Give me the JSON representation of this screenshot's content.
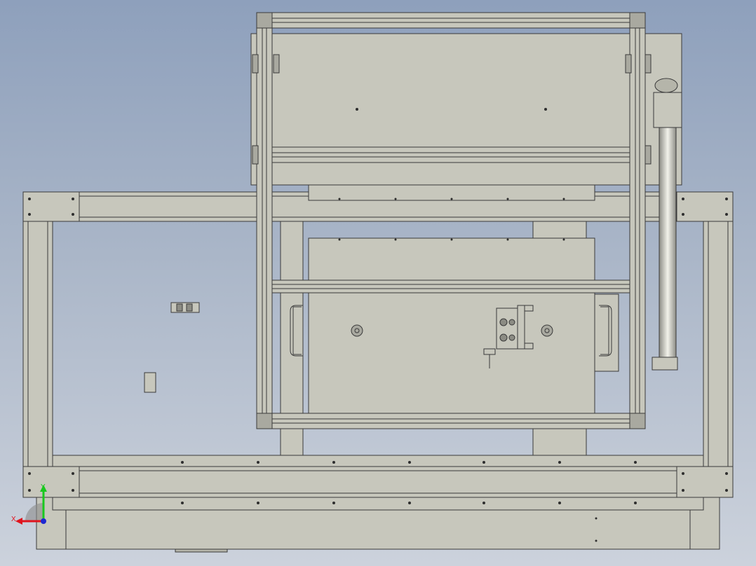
{
  "viewport": {
    "background_top": "#8ea0bc",
    "background_bottom": "#ccd2dc",
    "part_fill": "#c7c7bc",
    "part_fill_light": "#d4d4ca",
    "edge_color": "#3a3a3a"
  },
  "triad": {
    "x_label": "X",
    "y_label": "Y",
    "x_color": "#e0141e",
    "y_color": "#19c81e",
    "z_color": "#1e28d2"
  }
}
